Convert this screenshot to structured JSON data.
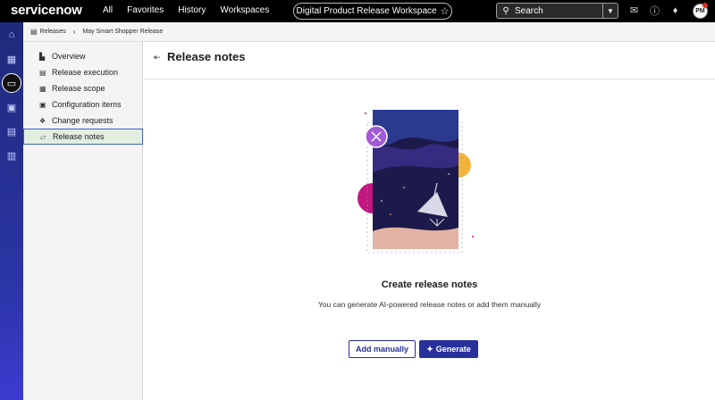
{
  "app": {
    "logo_text": "servicenow"
  },
  "topnav": {
    "items": [
      "All",
      "Favorites",
      "History",
      "Workspaces"
    ]
  },
  "workspace": {
    "label": "Digital Product Release Workspace"
  },
  "search": {
    "label": "Search"
  },
  "user": {
    "initials": "PM"
  },
  "breadcrumb": {
    "root": "Releases",
    "current": "May Smart Shopper Release"
  },
  "sidebar": {
    "items": [
      {
        "label": "Overview",
        "icon": "chart-icon"
      },
      {
        "label": "Release execution",
        "icon": "table-icon"
      },
      {
        "label": "Release scope",
        "icon": "list-icon"
      },
      {
        "label": "Configuration items",
        "icon": "grid-icon"
      },
      {
        "label": "Change requests",
        "icon": "shapes-icon"
      },
      {
        "label": "Release notes",
        "icon": "note-icon",
        "active": true
      }
    ]
  },
  "main": {
    "title": "Release notes",
    "empty_title": "Create release notes",
    "empty_subtitle": "You can generate AI-powered release notes or add them manually",
    "add_label": "Add manually",
    "generate_label": "Generate"
  },
  "colors": {
    "brand_blue": "#28309a",
    "rail": "#2b35a6",
    "active_bg": "#e2efe0"
  }
}
